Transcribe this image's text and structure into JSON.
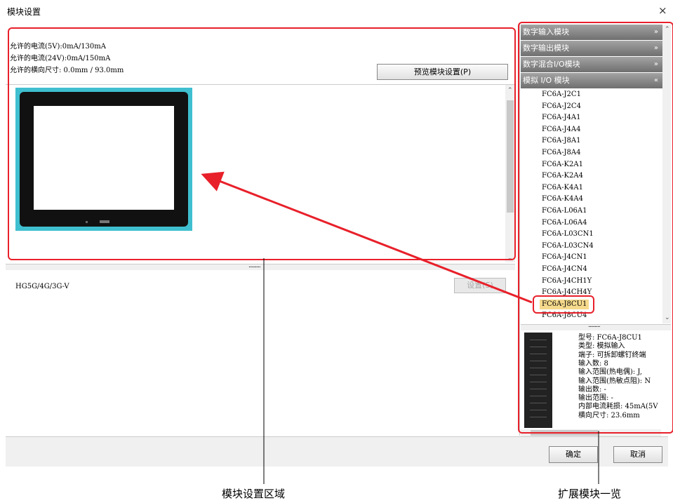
{
  "window": {
    "title": "模块设置",
    "close_glyph": "×"
  },
  "info": {
    "current_5v": "允许的电流(5V):0mA/130mA",
    "current_24v": "允许的电流(24V):0mA/150mA",
    "width": "允许的横向尺寸: 0.0mm / 93.0mm",
    "preview_button": "预览模块设置(P)"
  },
  "config": {
    "model": "HG5G/4G/3G-V",
    "settings_button": "设置(S)"
  },
  "buttons": {
    "ok": "确定",
    "cancel": "取消"
  },
  "categories": [
    {
      "label": "数字输入模块",
      "state": "collapsed"
    },
    {
      "label": "数字输出模块",
      "state": "collapsed"
    },
    {
      "label": "数字混合I/O模块",
      "state": "collapsed"
    },
    {
      "label": "模拟 I/O 模块",
      "state": "expanded"
    }
  ],
  "chevrons": {
    "collapsed": "»",
    "expanded": "«"
  },
  "modules": [
    "FC6A-J2C1",
    "FC6A-J2C4",
    "FC6A-J4A1",
    "FC6A-J4A4",
    "FC6A-J8A1",
    "FC6A-J8A4",
    "FC6A-K2A1",
    "FC6A-K2A4",
    "FC6A-K4A1",
    "FC6A-K4A4",
    "FC6A-L06A1",
    "FC6A-L06A4",
    "FC6A-L03CN1",
    "FC6A-L03CN4",
    "FC6A-J4CN1",
    "FC6A-J4CN4",
    "FC6A-J4CH1Y",
    "FC6A-J4CH4Y",
    "FC6A-J8CU1",
    "FC6A-J8CU4"
  ],
  "selected_module": "FC6A-J8CU1",
  "detail": [
    "型号: FC6A-J8CU1",
    "类型:  模拟输入",
    "端子: 可拆卸螺钉终端",
    "输入数: 8",
    "输入范围(热电偶): J,",
    "输入范围(热敏点阻): N",
    "输出数: -",
    "输出范围: -",
    "内部电流耗损: 45mA(5V",
    "横向尺寸: 23.6mm"
  ],
  "annotations": {
    "settings_area": "模块设置区域",
    "module_list": "扩展模块一览"
  },
  "colors": {
    "annotation": "#e8202a",
    "selected_bg": "#f5d98c",
    "category_bar": "#8a8a8a",
    "device_bezel": "#3fbfcf"
  }
}
